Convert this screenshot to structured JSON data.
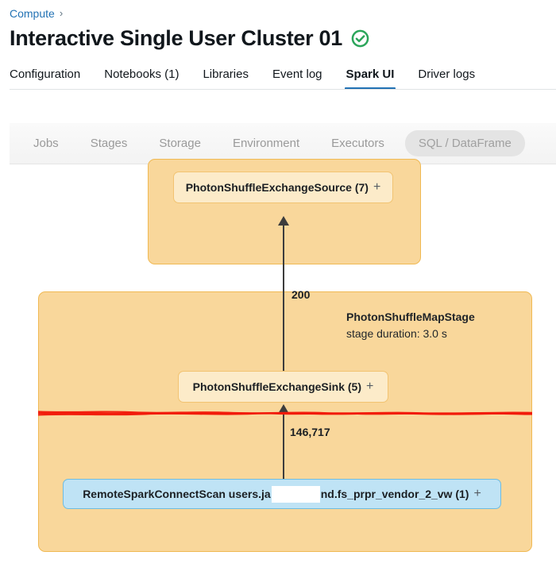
{
  "breadcrumb": {
    "items": [
      {
        "label": "Compute",
        "icon": ""
      }
    ],
    "separator": "›"
  },
  "header": {
    "title": "Interactive Single User Cluster 01",
    "status_icon": "check-circle-icon",
    "status_color": "#2BA55A"
  },
  "tabs": [
    {
      "label": "Configuration",
      "active": false
    },
    {
      "label": "Notebooks (1)",
      "active": false
    },
    {
      "label": "Libraries",
      "active": false
    },
    {
      "label": "Event log",
      "active": false
    },
    {
      "label": "Spark UI",
      "active": true
    },
    {
      "label": "Driver logs",
      "active": false
    }
  ],
  "subtabs": [
    {
      "label": "Jobs",
      "selected": false
    },
    {
      "label": "Stages",
      "selected": false
    },
    {
      "label": "Storage",
      "selected": false
    },
    {
      "label": "Environment",
      "selected": false
    },
    {
      "label": "Executors",
      "selected": false
    },
    {
      "label": "SQL / DataFrame",
      "selected": true
    }
  ],
  "dag": {
    "stages": [
      {
        "id": "stage-upper",
        "name": "",
        "duration": ""
      },
      {
        "id": "stage-lower",
        "name": "PhotonShuffleMapStage",
        "duration": "stage duration: 3.0 s"
      }
    ],
    "nodes": [
      {
        "id": "node-source",
        "label": "PhotonShuffleExchangeSource (7)",
        "expand": "+",
        "kind": "photon"
      },
      {
        "id": "node-sink",
        "label": "PhotonShuffleExchangeSink (5)",
        "expand": "+",
        "kind": "photon"
      },
      {
        "id": "node-scan",
        "label_before": "RemoteSparkConnectScan users.ja",
        "label_after": "nd.fs_prpr_vendor_2_vw (1)",
        "expand": "+",
        "kind": "scan",
        "redacted": true
      }
    ],
    "edges": [
      {
        "id": "edge-upper",
        "label": "200"
      },
      {
        "id": "edge-lower",
        "label": "146,717"
      }
    ],
    "annotation": {
      "type": "red-scribble-line",
      "color": "#F11A0B"
    },
    "colors": {
      "stage_fill": "#F9D79B",
      "stage_border": "#F0B953",
      "photon_node_fill": "#FCEBC9",
      "photon_node_border": "#F2C371",
      "scan_node_fill": "#BFE3F5",
      "scan_node_border": "#6DBCE2",
      "edge": "#3D3D3D"
    }
  }
}
